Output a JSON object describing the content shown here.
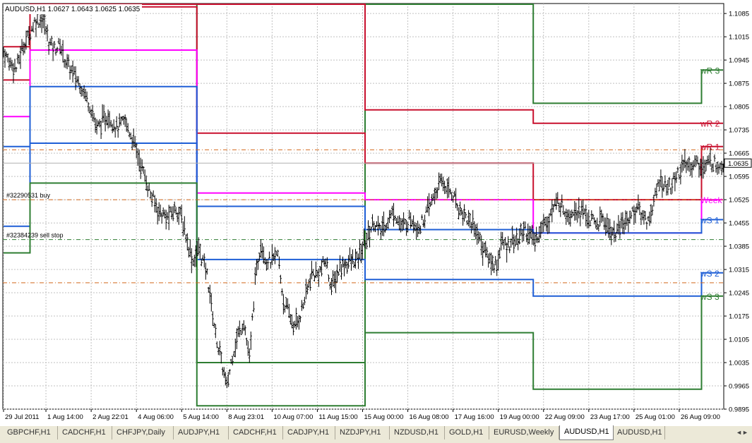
{
  "chart": {
    "header": "AUDUSD,H1  1.0627 1.0643 1.0625 1.0635",
    "current_price": "1.0635",
    "price_range": [
      0.9895,
      1.1115
    ],
    "price_ticks": [
      "1.1085",
      "1.1015",
      "1.0945",
      "1.0875",
      "1.0805",
      "1.0735",
      "1.0665",
      "1.0595",
      "1.0525",
      "1.0455",
      "1.0385",
      "1.0315",
      "1.0245",
      "1.0175",
      "1.0105",
      "1.0035",
      "0.9965",
      "0.9895"
    ],
    "price_tick_values": [
      1.1085,
      1.1015,
      1.0945,
      1.0875,
      1.0805,
      1.0735,
      1.0665,
      1.0595,
      1.0525,
      1.0455,
      1.0385,
      1.0315,
      1.0245,
      1.0175,
      1.0105,
      1.0035,
      0.9965,
      0.9895
    ],
    "time_ticks": [
      "29 Jul 2011",
      "1 Aug 14:00",
      "2 Aug 22:01",
      "4 Aug 06:00",
      "5 Aug 14:00",
      "8 Aug 23:01",
      "10 Aug 07:00",
      "11 Aug 15:00",
      "15 Aug 00:00",
      "16 Aug 08:00",
      "17 Aug 16:00",
      "19 Aug 00:00",
      "22 Aug 09:00",
      "23 Aug 17:00",
      "25 Aug 01:00",
      "26 Aug 09:00"
    ],
    "time_tick_index": [
      0,
      30,
      62,
      94,
      126,
      158,
      190,
      222,
      254,
      286,
      318,
      350,
      382,
      414,
      446,
      478
    ],
    "bar_count": 510,
    "weeks": [
      {
        "start": 0,
        "end": 19,
        "levels": {
          "wR3": 1.1105,
          "wR2": 1.0985,
          "wR1": 1.0885,
          "Week": 1.0775,
          "wS1": 1.0685,
          "wS2": 1.0445,
          "wS3": 1.0365
        }
      },
      {
        "start": 19,
        "end": 137,
        "levels": {
          "wR3": 1.1125,
          "wR2": 1.1125,
          "wR1": 1.1105,
          "Week": 1.0975,
          "wS1": 1.0865,
          "wS2": 1.0695,
          "wS3": 1.0575
        }
      },
      {
        "start": 137,
        "end": 256,
        "levels": {
          "wR3": 0.9905,
          "wR2": 1.1125,
          "wR1": 1.0725,
          "Week": 1.0545,
          "wS1": 1.0505,
          "wS2": 1.0345,
          "wS3": 1.0035
        }
      },
      {
        "start": 256,
        "end": 375,
        "levels": {
          "wR3": 1.1125,
          "wR2": 1.0795,
          "wR1": 1.0635,
          "Week": 1.0525,
          "wS1": 1.0435,
          "wS2": 1.0285,
          "wS3": 1.0125
        }
      },
      {
        "start": 375,
        "end": 494,
        "levels": {
          "wR3": 1.0815,
          "wR2": 1.0755,
          "wR1": 1.0525,
          "Week": 1.0425,
          "wS1": 1.0425,
          "wS2": 1.0235,
          "wS3": 0.9955
        }
      },
      {
        "start": 494,
        "end": 510,
        "levels": {
          "wR3": 1.0915,
          "wR2": 1.0755,
          "wR1": 1.0685,
          "Week": 1.0525,
          "wS1": 1.0465,
          "wS2": 1.0305,
          "wS3": 1.0235
        }
      }
    ],
    "level_colors": {
      "wR3": "#2e7d32",
      "wR2": "#c8102e",
      "wR1": "#c8102e",
      "Week": "#ff00ff",
      "wS1": "#1f5fd6",
      "wS2": "#1f5fd6",
      "wS3": "#2e7d32"
    },
    "level_labels": [
      {
        "key": "wR3",
        "text": "wR 3"
      },
      {
        "key": "wR2",
        "text": "wR 2"
      },
      {
        "key": "wR1",
        "text": "wR 1"
      },
      {
        "key": "Week",
        "text": "Week"
      },
      {
        "key": "wS1",
        "text": "wS 1"
      },
      {
        "key": "wS2",
        "text": "wS 2"
      },
      {
        "key": "wS3",
        "text": "wS 3"
      }
    ],
    "orders": [
      {
        "label": "#32290531 buy",
        "price": 1.0525,
        "color": "#d2691e",
        "style": "dash-dot"
      },
      {
        "label": "#32384239 sell stop",
        "price": 1.0405,
        "color": "#2e7d32",
        "style": "dash-dot"
      },
      {
        "label": "",
        "price": 1.0675,
        "color": "#d2691e",
        "style": "dash-dot"
      },
      {
        "label": "",
        "price": 1.0275,
        "color": "#d2691e",
        "style": "dash-dot"
      }
    ],
    "price_keypoints": [
      [
        0,
        1.097
      ],
      [
        4,
        1.094
      ],
      [
        9,
        1.092
      ],
      [
        14,
        1.099
      ],
      [
        18,
        1.102
      ],
      [
        22,
        1.106
      ],
      [
        28,
        1.107
      ],
      [
        32,
        1.1
      ],
      [
        36,
        1.098
      ],
      [
        40,
        1.099
      ],
      [
        44,
        1.094
      ],
      [
        50,
        1.09
      ],
      [
        56,
        1.086
      ],
      [
        62,
        1.08
      ],
      [
        66,
        1.074
      ],
      [
        70,
        1.076
      ],
      [
        74,
        1.078
      ],
      [
        80,
        1.074
      ],
      [
        86,
        1.076
      ],
      [
        92,
        1.07
      ],
      [
        98,
        1.062
      ],
      [
        104,
        1.054
      ],
      [
        110,
        1.049
      ],
      [
        116,
        1.047
      ],
      [
        122,
        1.05
      ],
      [
        126,
        1.047
      ],
      [
        130,
        1.04
      ],
      [
        134,
        1.034
      ],
      [
        138,
        1.038
      ],
      [
        144,
        1.03
      ],
      [
        150,
        1.012
      ],
      [
        154,
        1.004
      ],
      [
        158,
        0.996
      ],
      [
        162,
        1.006
      ],
      [
        166,
        1.012
      ],
      [
        170,
        1.016
      ],
      [
        174,
        1.004
      ],
      [
        178,
        1.028
      ],
      [
        182,
        1.04
      ],
      [
        186,
        1.034
      ],
      [
        190,
        1.034
      ],
      [
        194,
        1.036
      ],
      [
        198,
        1.022
      ],
      [
        202,
        1.018
      ],
      [
        206,
        1.014
      ],
      [
        210,
        1.018
      ],
      [
        214,
        1.024
      ],
      [
        218,
        1.03
      ],
      [
        222,
        1.03
      ],
      [
        228,
        1.034
      ],
      [
        232,
        1.026
      ],
      [
        238,
        1.032
      ],
      [
        244,
        1.034
      ],
      [
        250,
        1.034
      ],
      [
        254,
        1.038
      ],
      [
        258,
        1.042
      ],
      [
        262,
        1.046
      ],
      [
        266,
        1.043
      ],
      [
        270,
        1.045
      ],
      [
        276,
        1.049
      ],
      [
        282,
        1.044
      ],
      [
        288,
        1.047
      ],
      [
        294,
        1.044
      ],
      [
        300,
        1.049
      ],
      [
        306,
        1.055
      ],
      [
        310,
        1.058
      ],
      [
        314,
        1.056
      ],
      [
        318,
        1.054
      ],
      [
        322,
        1.05
      ],
      [
        328,
        1.047
      ],
      [
        334,
        1.044
      ],
      [
        338,
        1.039
      ],
      [
        342,
        1.036
      ],
      [
        346,
        1.033
      ],
      [
        350,
        1.034
      ],
      [
        352,
        1.04
      ],
      [
        356,
        1.038
      ],
      [
        360,
        1.041
      ],
      [
        364,
        1.04
      ],
      [
        368,
        1.044
      ],
      [
        372,
        1.042
      ],
      [
        376,
        1.04
      ],
      [
        380,
        1.044
      ],
      [
        384,
        1.046
      ],
      [
        388,
        1.049
      ],
      [
        392,
        1.052
      ],
      [
        396,
        1.05
      ],
      [
        400,
        1.048
      ],
      [
        404,
        1.05
      ],
      [
        408,
        1.049
      ],
      [
        412,
        1.048
      ],
      [
        416,
        1.046
      ],
      [
        420,
        1.045
      ],
      [
        424,
        1.047
      ],
      [
        428,
        1.044
      ],
      [
        432,
        1.042
      ],
      [
        436,
        1.044
      ],
      [
        440,
        1.046
      ],
      [
        444,
        1.048
      ],
      [
        448,
        1.05
      ],
      [
        452,
        1.048
      ],
      [
        456,
        1.046
      ],
      [
        460,
        1.052
      ],
      [
        464,
        1.058
      ],
      [
        468,
        1.057
      ],
      [
        472,
        1.056
      ],
      [
        476,
        1.06
      ],
      [
        480,
        1.062
      ],
      [
        484,
        1.063
      ],
      [
        490,
        1.0635
      ],
      [
        496,
        1.062
      ],
      [
        500,
        1.064
      ],
      [
        504,
        1.063
      ],
      [
        509,
        1.0635
      ]
    ]
  },
  "tabs": [
    {
      "label": "GBPCHF,H1",
      "active": false
    },
    {
      "label": "CADCHF,H1",
      "active": false
    },
    {
      "label": "CHFJPY,Daily",
      "active": false
    },
    {
      "label": "AUDJPY,H1",
      "active": false
    },
    {
      "label": "CADCHF,H1",
      "active": false
    },
    {
      "label": "CADJPY,H1",
      "active": false
    },
    {
      "label": "NZDJPY,H1",
      "active": false
    },
    {
      "label": "NZDUSD,H1",
      "active": false
    },
    {
      "label": "GOLD,H1",
      "active": false
    },
    {
      "label": "EURUSD,Weekly",
      "active": false
    },
    {
      "label": "AUDUSD,H1",
      "active": true
    },
    {
      "label": "AUDUSD,H1",
      "active": false
    }
  ],
  "tab_scroll": "◄►"
}
